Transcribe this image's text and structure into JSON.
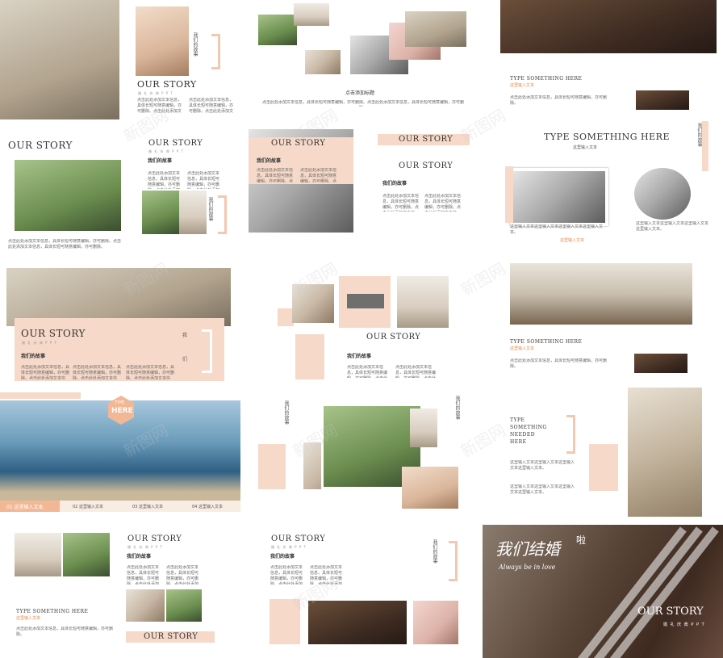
{
  "story": "OUR STORY",
  "subtitle_en": "婚 礼 庆 典 P P T",
  "our_story_cn": "我们的故事",
  "add_title": "点击添加标题",
  "body_text": "点击此处添加文本信息，具体长短可随意编辑，亦可删除。点击此处添加文本信息，具体长短可随意编辑，亦可删除。",
  "body_short": "点击此处添加文本信息，具体长短可随意编辑，亦可删除。",
  "type_something": "TYPE SOMETHING HERE",
  "type_something_needed": "TYPE SOMETHING NEEDED HERE",
  "input_text": "这里输入文本",
  "input_long": "这里输入文本这里输入文本这里输入文本这里输入文本。",
  "input_red": "这里输入文本",
  "vertical_cn": "我们的故事",
  "vertical_wo": "我",
  "vertical_men": "们",
  "type_here_badge": [
    "TYPE",
    "HERE"
  ],
  "tabs": [
    "01 这里输入文本",
    "02 这里输入文本",
    "03 这里输入文本",
    "04 这里输入文本"
  ],
  "cover_title": "我们结婚",
  "cover_la": "啦",
  "cover_script": "Always be in love",
  "cover_story": "OUR STORY",
  "cover_sub": "婚 礼 庆 典 P P T",
  "watermark": "新图网",
  "colors": {
    "accent": "#f6d9c8",
    "orange": "#e8874c"
  }
}
